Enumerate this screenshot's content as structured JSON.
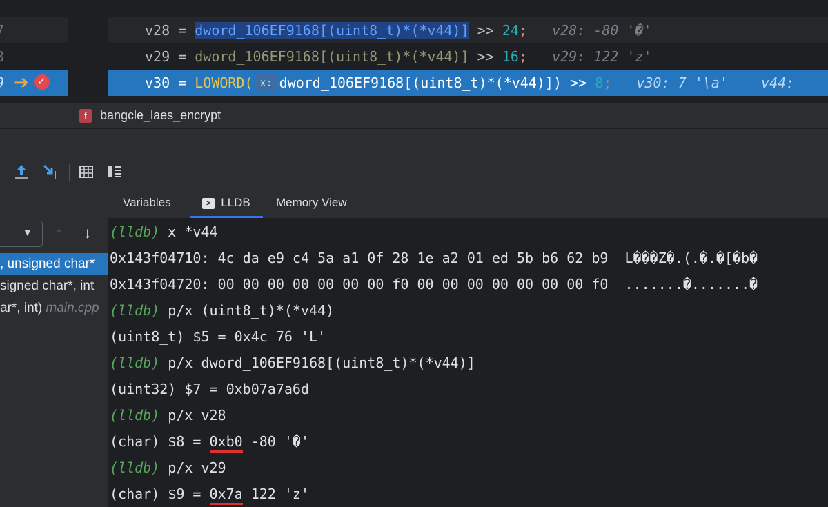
{
  "editor": {
    "lines": [
      {
        "no": "7",
        "var": "v28",
        "array": "dword_106EF9168[(uint8_t)*(*v44)]",
        "shift": "24",
        "hint": "v28: -80 '�'"
      },
      {
        "no": "8",
        "var": "v29",
        "array": "dword_106EF9168[(uint8_t)*(*v44)]",
        "shift": "16",
        "hint": "v29: 122 'z'"
      },
      {
        "no": "9",
        "var": "v30",
        "func": "LOWORD(",
        "chip": "x:",
        "array": "dword_106EF9168[(uint8_t)*(*v44)])",
        "shift": "8",
        "hint": "v30: 7 '\\a'",
        "hint2": "v44:"
      }
    ],
    "execution_arrow": "arrow-right-icon",
    "breakpoint": "breakpoint-icon"
  },
  "breadcrumb": {
    "icon_letter": "f",
    "label": "bangcle_laes_encrypt"
  },
  "toolbar": {
    "icons": [
      "step-out-icon",
      "run-to-cursor-icon",
      "evaluate-table-icon",
      "layout-icon"
    ]
  },
  "frames": {
    "items": [
      {
        "text": ", unsigned char*",
        "selected": true,
        "file": ""
      },
      {
        "text": "signed char*, int",
        "selected": false,
        "file": ""
      },
      {
        "text": "ar*, int) ",
        "selected": false,
        "file": "main.cpp"
      }
    ]
  },
  "tabs": [
    {
      "label": "Variables",
      "active": false
    },
    {
      "label": "LLDB",
      "active": true
    },
    {
      "label": "Memory View",
      "active": false
    }
  ],
  "console": {
    "prompt": "(lldb)",
    "lines": [
      {
        "type": "cmd",
        "text": " x *v44"
      },
      {
        "type": "out",
        "text": "0x143f04710: 4c da e9 c4 5a a1 0f 28 1e a2 01 ed 5b b6 62 b9  L���Z�.(.�.�[�b�"
      },
      {
        "type": "out",
        "text": "0x143f04720: 00 00 00 00 00 00 00 f0 00 00 00 00 00 00 00 f0  .......�.......�"
      },
      {
        "type": "cmd",
        "text": " p/x (uint8_t)*(*v44)"
      },
      {
        "type": "out",
        "text": "(uint8_t) $5 = 0x4c 76 'L'"
      },
      {
        "type": "cmd",
        "text": " p/x dword_106EF9168[(uint8_t)*(*v44)]"
      },
      {
        "type": "out",
        "text": "(uint32) $7 = 0xb07a7a6d"
      },
      {
        "type": "cmd",
        "text": " p/x v28"
      },
      {
        "type": "out_ul",
        "pre": "(char) $8 = ",
        "ul": "0xb0",
        "post": " -80 '�'"
      },
      {
        "type": "cmd",
        "text": " p/x v29"
      },
      {
        "type": "out_ul",
        "pre": "(char) $9 = ",
        "ul": "0x7a",
        "post": " 122 'z'"
      }
    ]
  }
}
